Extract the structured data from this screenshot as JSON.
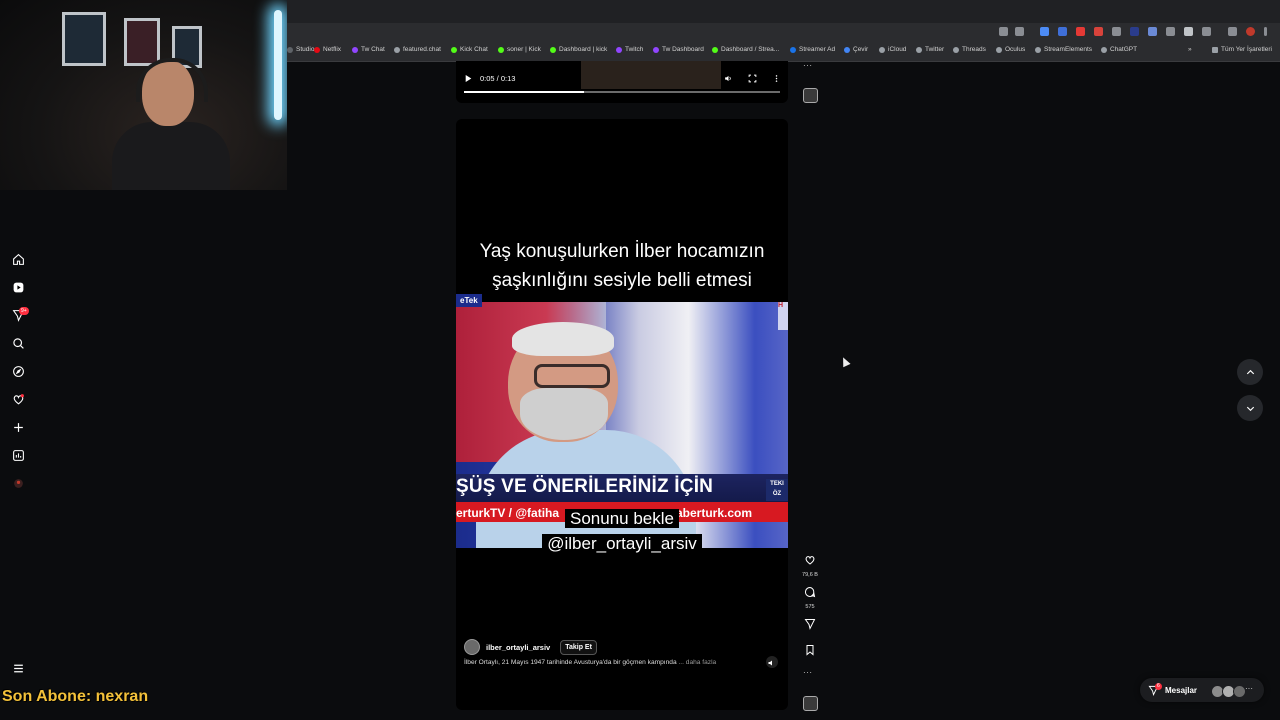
{
  "bookmarks": [
    {
      "label": "Studio",
      "color": "#5f6368"
    },
    {
      "label": "Netflix",
      "color": "#e50914"
    },
    {
      "label": "Tw Chat",
      "color": "#9146ff"
    },
    {
      "label": "featured.chat",
      "color": "#9aa0a6"
    },
    {
      "label": "Kick Chat",
      "color": "#53fc18"
    },
    {
      "label": "soner | Kick",
      "color": "#53fc18"
    },
    {
      "label": "Dashboard | kick",
      "color": "#53fc18"
    },
    {
      "label": "Twitch",
      "color": "#9146ff"
    },
    {
      "label": "Tw Dashboard",
      "color": "#9146ff"
    },
    {
      "label": "Dashboard / Strea...",
      "color": "#53fc18"
    },
    {
      "label": "Streamer Ad",
      "color": "#1a73e8"
    },
    {
      "label": "Çevir",
      "color": "#4285f4"
    },
    {
      "label": "iCloud",
      "color": "#9aa0a6"
    },
    {
      "label": "Twitter",
      "color": "#9aa0a6"
    },
    {
      "label": "Threads",
      "color": "#9aa0a6"
    },
    {
      "label": "Oculus",
      "color": "#9aa0a6"
    },
    {
      "label": "StreamElements",
      "color": "#9aa0a6"
    },
    {
      "label": "ChatGPT",
      "color": "#9aa0a6"
    }
  ],
  "bookmarks_overflow": "»",
  "bookmarks_all": "Tüm Yer İşaretleri",
  "stream_overlay": {
    "last_sub": "Son Abone: nexran"
  },
  "sidebar": {
    "notification_badge": "9+"
  },
  "previous_post": {
    "time": "0:05 / 0:13",
    "progress": 0.38
  },
  "reel": {
    "caption_top_line1": "Yaş konuşulurken İlber hocamızın",
    "caption_top_line2": "şaşkınlığını sesiyle belli etmesi",
    "tv_logo_left": "eTek",
    "tv_logo_right": "H",
    "ticker_main": "ŞÜŞ VE ÖNERİLERİNİZ İÇİN",
    "ticker_tag": "TEKI ÖZ",
    "ticker_sub_left": "erturkTV / @fatiha",
    "ticker_sub_right": "aberturk.com",
    "caption_bottom_line1": "Sonunu bekle",
    "caption_bottom_line2": "@ilber_ortayli_arsiv",
    "username": "ilber_ortayli_arsiv",
    "follow_label": "Takip Et",
    "description": "İlber Ortaylı, 21 Mayıs 1947 tarihinde Avusturya'da bir göçmen kampında",
    "more_label": "... daha fazla"
  },
  "actions": {
    "likes": "79,6 B",
    "comments": "575"
  },
  "messages": {
    "label": "Mesajlar",
    "badge": "6"
  },
  "colors": {
    "accent_badge": "#ff3040",
    "overlay_text": "#f3c13a"
  }
}
